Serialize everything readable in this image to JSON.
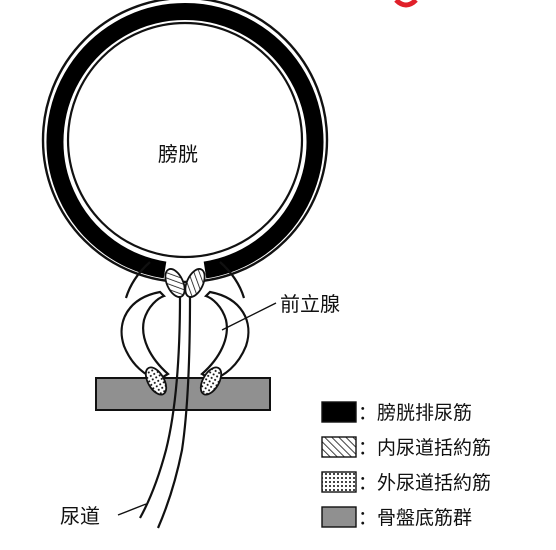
{
  "labels": {
    "bladder": "膀胱",
    "prostate": "前立腺",
    "urethra": "尿道"
  },
  "legend": [
    {
      "pattern": "solid-black",
      "text": "：膀胱排尿筋"
    },
    {
      "pattern": "diagonal-hatch",
      "text": "：内尿道括約筋"
    },
    {
      "pattern": "dotted",
      "text": "：外尿道括約筋"
    },
    {
      "pattern": "solid-gray",
      "text": "：骨盤底筋群"
    }
  ],
  "colors": {
    "detrusor": "#000000",
    "pelvic_floor": "#909090",
    "outline": "#111111",
    "accent_partial": "#e0202a"
  }
}
